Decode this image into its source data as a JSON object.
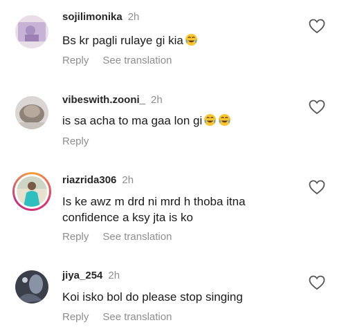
{
  "comments": [
    {
      "username": "sojilimonika",
      "time": "2h",
      "text": "Bs kr pagli rulaye gi kia",
      "emojis": [
        "tears-of-joy-emoji"
      ],
      "reply_label": "Reply",
      "translation_label": "See translation",
      "avatar_icon": "avatar-image"
    },
    {
      "username": "vibeswith.zooni_",
      "time": "2h",
      "text": "is sa acha to ma gaa lon gi",
      "emojis": [
        "tears-of-joy-emoji",
        "tears-of-joy-emoji"
      ],
      "reply_label": "Reply",
      "avatar_icon": "avatar-image"
    },
    {
      "username": "riazrida306",
      "time": "2h",
      "text": "Is ke awz m drd ni mrd h thoba  itna confidence a ksy jta is ko",
      "reply_label": "Reply",
      "translation_label": "See translation",
      "avatar_icon": "avatar-image-story-ring"
    },
    {
      "username": "jiya_254",
      "time": "2h",
      "text": "Koi isko bol do please stop singing",
      "reply_label": "Reply",
      "translation_label": "See translation",
      "avatar_icon": "avatar-image"
    }
  ],
  "colors": {
    "username": "#262626",
    "muted": "#8e8e8e",
    "text": "#1a1a1a",
    "story_ring_start": "#f9a23b",
    "story_ring_end": "#c13584"
  }
}
